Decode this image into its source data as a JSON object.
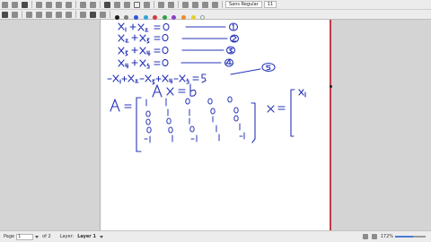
{
  "toolbar": {
    "font_name": "Sans Regular",
    "font_size": "11",
    "colors": [
      "#1b1b1b",
      "#7a7a7a",
      "#2a56d6",
      "#33a1e0",
      "#d23a3a",
      "#2f9e47",
      "#8a3fc6",
      "#f08a24",
      "#e5d02a",
      "#f4f4f4"
    ]
  },
  "statusbar": {
    "page_label": "Page",
    "page_value": "1",
    "page_of": "of 2",
    "layer_label": "Layer:",
    "layer_value": "Layer 1",
    "zoom_value": "172%",
    "zoom_fraction": 0.6
  }
}
